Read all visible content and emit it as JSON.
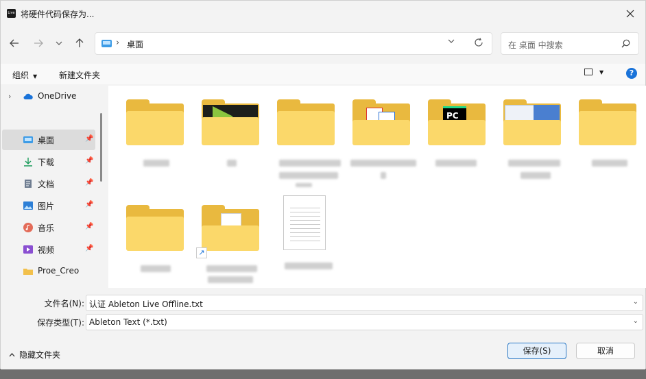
{
  "titlebar": {
    "title": "将硬件代码保存为...",
    "app_icon_text": "Live"
  },
  "address": {
    "location": "桌面"
  },
  "search": {
    "placeholder": "在 桌面 中搜索"
  },
  "toolbar": {
    "organize": "组织",
    "new_folder": "新建文件夹"
  },
  "sidebar": {
    "items": [
      {
        "label": "OneDrive"
      },
      {
        "label": "桌面"
      },
      {
        "label": "下载"
      },
      {
        "label": "文档"
      },
      {
        "label": "图片"
      },
      {
        "label": "音乐"
      },
      {
        "label": "视频"
      },
      {
        "label": "Proe_Creo"
      }
    ]
  },
  "footer": {
    "filename_label": "文件名(N):",
    "filename_value": "认证 Ableton Live Offline.txt",
    "filetype_label": "保存类型(T):",
    "filetype_value": "Ableton Text (*.txt)",
    "hide_folders": "隐藏文件夹",
    "save_button": "保存(S)",
    "cancel_button": "取消"
  },
  "colors": {
    "accent": "#1a73d9",
    "folder": "#fbd86a",
    "selection": "#dcdcdc"
  }
}
